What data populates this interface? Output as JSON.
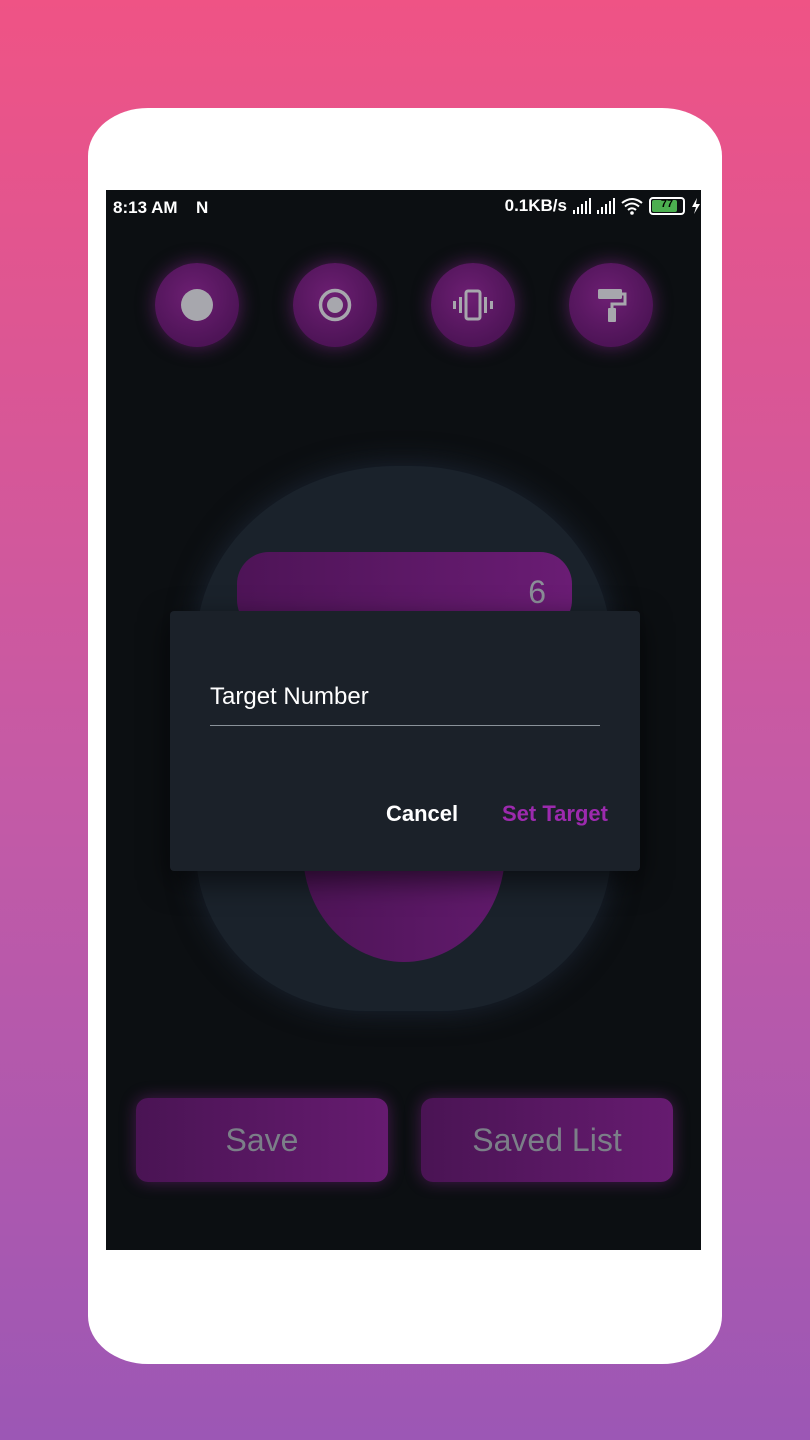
{
  "status_bar": {
    "time": "8:13 AM",
    "notification_icon": "N",
    "network_speed": "0.1KB/s",
    "battery_level": "77"
  },
  "top_controls": [
    {
      "icon": "dot-icon"
    },
    {
      "icon": "radio-target-icon"
    },
    {
      "icon": "vibrate-icon"
    },
    {
      "icon": "paint-roller-icon"
    }
  ],
  "counter": {
    "display_value": "6"
  },
  "dialog": {
    "input_placeholder": "Target Number",
    "input_value": "",
    "cancel_label": "Cancel",
    "confirm_label": "Set Target"
  },
  "bottom": {
    "save_label": "Save",
    "saved_list_label": "Saved List"
  },
  "colors": {
    "accent": "#9c2aae",
    "button_purple": "#5a1763",
    "screen_bg": "#0c0f12",
    "dialog_bg": "#1b2129"
  }
}
